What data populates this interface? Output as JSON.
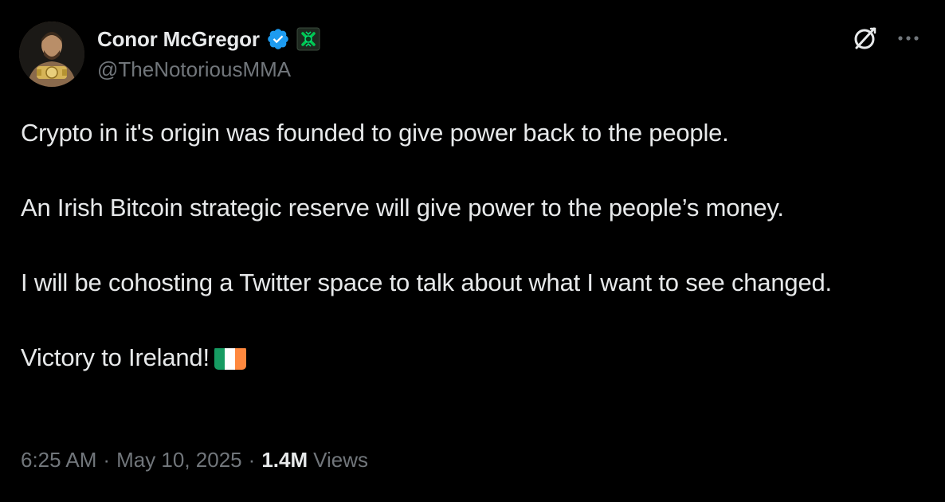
{
  "author": {
    "display_name": "Conor McGregor",
    "handle": "@TheNotoriousMMA",
    "verified_color": "#1d9bf0",
    "affiliate_badge_color": "#00c853",
    "verified_icon": "verified-badge-icon",
    "affiliate_icon": "affiliate-badge-icon"
  },
  "header_actions": {
    "grok_icon": "grok-icon",
    "more_icon": "more-options-icon"
  },
  "tweet": {
    "paragraphs": [
      "Crypto in it's origin was founded to give power back to the people.",
      "An Irish Bitcoin strategic reserve will give power to the people’s money.",
      "I will be cohosting a Twitter space to talk about what I want to see changed.",
      "Victory to Ireland!"
    ],
    "flag_icon": "ireland-flag-icon",
    "flag_colors": [
      "#169b62",
      "#ffffff",
      "#ff883e"
    ]
  },
  "meta": {
    "time": "6:25 AM",
    "date": "May 10, 2025",
    "separator": "·",
    "views_count": "1.4M",
    "views_label": "Views"
  },
  "colors": {
    "background": "#000000",
    "primary_text": "#e7e9ea",
    "secondary_text": "#71767b"
  }
}
